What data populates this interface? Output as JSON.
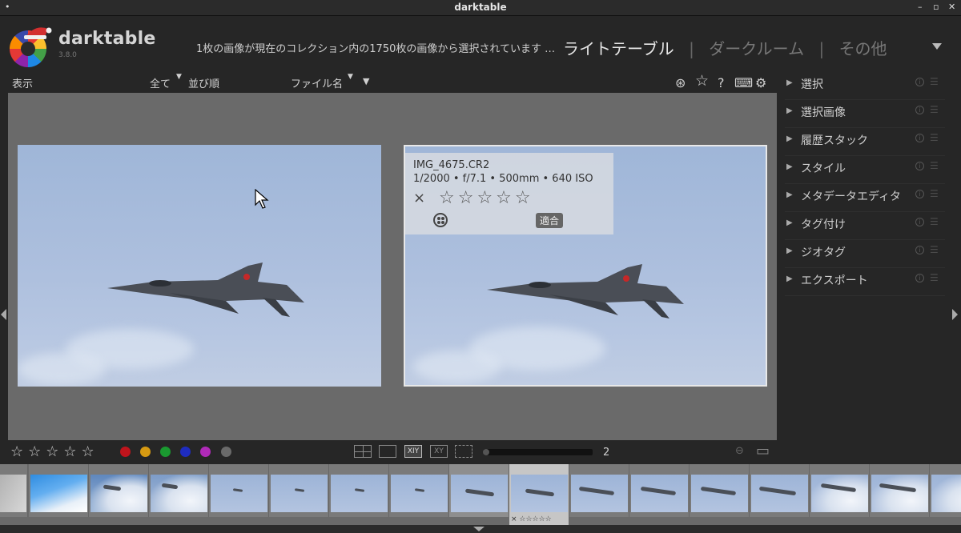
{
  "window": {
    "title": "darktable"
  },
  "header": {
    "app_name": "darktable",
    "version": "3.8.0",
    "collection_info": "1枚の画像が現在のコレクション内の1750枚の画像から選択されています …",
    "views": {
      "lighttable": "ライトテーブル",
      "separator": "|",
      "darkroom": "ダークルーム",
      "other": "その他"
    }
  },
  "toolbar": {
    "display_label": "表示",
    "filter_value": "全て",
    "sort_label": "並び順",
    "sort_value": "ファイル名"
  },
  "overlay": {
    "filename": "IMG_4675.CR2",
    "exif": "1/2000 • f/7.1 • 500mm • 640 ISO",
    "reject": "×",
    "stars": "☆☆☆☆☆",
    "fit_label": "適合"
  },
  "bottom": {
    "stars": "☆☆☆☆☆",
    "color_labels": [
      "#c0141c",
      "#d69a12",
      "#1a9a30",
      "#1e2cc0",
      "#b02ab8",
      "#6a6a6a"
    ],
    "zoom_value": "2"
  },
  "right_panel": {
    "modules": [
      "選択",
      "選択画像",
      "履歴スタック",
      "スタイル",
      "メタデータエディタ",
      "タグ付け",
      "ジオタグ",
      "エクスポート"
    ]
  },
  "filmstrip": {
    "hover_caption": "× ☆☆☆☆☆"
  }
}
